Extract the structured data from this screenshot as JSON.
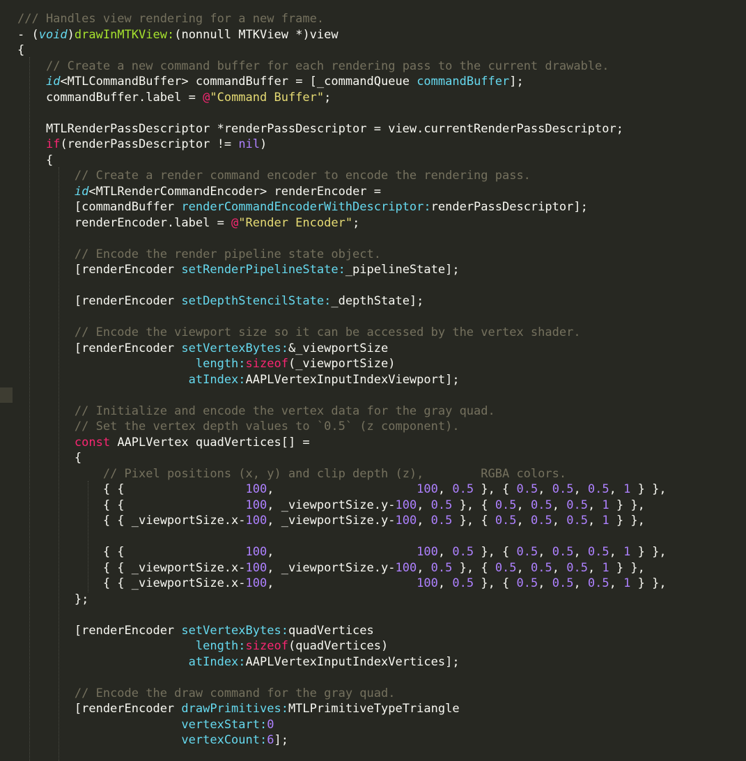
{
  "editor": {
    "theme": "monokai",
    "colors": {
      "background": "#272822",
      "comment": "#75715e",
      "keyword": "#f92672",
      "string": "#e6db74",
      "number": "#ae81ff",
      "function": "#a6e22e",
      "type": "#66d9ef",
      "plain": "#f8f8f2"
    },
    "lines": [
      [
        [
          "cm",
          "/// Handles view rendering for a new frame."
        ]
      ],
      [
        [
          "pl",
          "- ("
        ],
        [
          "ty",
          "void"
        ],
        [
          "pl",
          ")"
        ],
        [
          "fn",
          "drawInMTKView:"
        ],
        [
          "pl",
          "(nonnull MTKView *)view"
        ]
      ],
      [
        [
          "pl",
          "{"
        ]
      ],
      [
        [
          "pl",
          "    "
        ],
        [
          "cm",
          "// Create a new command buffer for each rendering pass to the current drawable."
        ]
      ],
      [
        [
          "pl",
          "    "
        ],
        [
          "ty",
          "id"
        ],
        [
          "pl",
          "<MTLCommandBuffer> commandBuffer = [_commandQueue "
        ],
        [
          "ms",
          "commandBuffer"
        ],
        [
          "pl",
          "];"
        ]
      ],
      [
        [
          "pl",
          "    commandBuffer.label = "
        ],
        [
          "kw",
          "@"
        ],
        [
          "st",
          "\"Command Buffer\""
        ],
        [
          "pl",
          ";"
        ]
      ],
      [
        [
          "pl",
          ""
        ]
      ],
      [
        [
          "pl",
          "    MTLRenderPassDescriptor *renderPassDescriptor = view.currentRenderPassDescriptor;"
        ]
      ],
      [
        [
          "pl",
          "    "
        ],
        [
          "kw",
          "if"
        ],
        [
          "pl",
          "(renderPassDescriptor != "
        ],
        [
          "nu",
          "nil"
        ],
        [
          "pl",
          ")"
        ]
      ],
      [
        [
          "pl",
          "    {"
        ]
      ],
      [
        [
          "pl",
          "        "
        ],
        [
          "cm",
          "// Create a render command encoder to encode the rendering pass."
        ]
      ],
      [
        [
          "pl",
          "        "
        ],
        [
          "ty",
          "id"
        ],
        [
          "pl",
          "<MTLRenderCommandEncoder> renderEncoder ="
        ]
      ],
      [
        [
          "pl",
          "        [commandBuffer "
        ],
        [
          "ms",
          "renderCommandEncoderWithDescriptor:"
        ],
        [
          "pl",
          "renderPassDescriptor];"
        ]
      ],
      [
        [
          "pl",
          "        renderEncoder.label = "
        ],
        [
          "kw",
          "@"
        ],
        [
          "st",
          "\"Render Encoder\""
        ],
        [
          "pl",
          ";"
        ]
      ],
      [
        [
          "pl",
          ""
        ]
      ],
      [
        [
          "pl",
          "        "
        ],
        [
          "cm",
          "// Encode the render pipeline state object."
        ]
      ],
      [
        [
          "pl",
          "        [renderEncoder "
        ],
        [
          "ms",
          "setRenderPipelineState:"
        ],
        [
          "pl",
          "_pipelineState];"
        ]
      ],
      [
        [
          "pl",
          ""
        ]
      ],
      [
        [
          "pl",
          "        [renderEncoder "
        ],
        [
          "ms",
          "setDepthStencilState:"
        ],
        [
          "pl",
          "_depthState];"
        ]
      ],
      [
        [
          "pl",
          ""
        ]
      ],
      [
        [
          "pl",
          "        "
        ],
        [
          "cm",
          "// Encode the viewport size so it can be accessed by the vertex shader."
        ]
      ],
      [
        [
          "pl",
          "        [renderEncoder "
        ],
        [
          "ms",
          "setVertexBytes:"
        ],
        [
          "pl",
          "&_viewportSize"
        ]
      ],
      [
        [
          "pl",
          "                         "
        ],
        [
          "ms",
          "length:"
        ],
        [
          "kw",
          "sizeof"
        ],
        [
          "pl",
          "(_viewportSize)"
        ]
      ],
      [
        [
          "pl",
          "                        "
        ],
        [
          "ms",
          "atIndex:"
        ],
        [
          "pl",
          "AAPLVertexInputIndexViewport];"
        ]
      ],
      [
        [
          "pl",
          ""
        ]
      ],
      [
        [
          "pl",
          "        "
        ],
        [
          "cm",
          "// Initialize and encode the vertex data for the gray quad."
        ]
      ],
      [
        [
          "pl",
          "        "
        ],
        [
          "cm",
          "// Set the vertex depth values to `0.5` (z component)."
        ]
      ],
      [
        [
          "pl",
          "        "
        ],
        [
          "kw",
          "const"
        ],
        [
          "pl",
          " AAPLVertex quadVertices[] ="
        ]
      ],
      [
        [
          "pl",
          "        {"
        ]
      ],
      [
        [
          "pl",
          "            "
        ],
        [
          "cm",
          "// Pixel positions (x, y) and clip depth (z),        RGBA colors."
        ]
      ],
      [
        [
          "pl",
          "            { {                 "
        ],
        [
          "nu",
          "100"
        ],
        [
          "pl",
          ",                    "
        ],
        [
          "nu",
          "100"
        ],
        [
          "pl",
          ", "
        ],
        [
          "nu",
          "0.5"
        ],
        [
          "pl",
          " }, { "
        ],
        [
          "nu",
          "0.5"
        ],
        [
          "pl",
          ", "
        ],
        [
          "nu",
          "0.5"
        ],
        [
          "pl",
          ", "
        ],
        [
          "nu",
          "0.5"
        ],
        [
          "pl",
          ", "
        ],
        [
          "nu",
          "1"
        ],
        [
          "pl",
          " } },"
        ]
      ],
      [
        [
          "pl",
          "            { {                 "
        ],
        [
          "nu",
          "100"
        ],
        [
          "pl",
          ", _viewportSize.y-"
        ],
        [
          "nu",
          "100"
        ],
        [
          "pl",
          ", "
        ],
        [
          "nu",
          "0.5"
        ],
        [
          "pl",
          " }, { "
        ],
        [
          "nu",
          "0.5"
        ],
        [
          "pl",
          ", "
        ],
        [
          "nu",
          "0.5"
        ],
        [
          "pl",
          ", "
        ],
        [
          "nu",
          "0.5"
        ],
        [
          "pl",
          ", "
        ],
        [
          "nu",
          "1"
        ],
        [
          "pl",
          " } },"
        ]
      ],
      [
        [
          "pl",
          "            { { _viewportSize.x-"
        ],
        [
          "nu",
          "100"
        ],
        [
          "pl",
          ", _viewportSize.y-"
        ],
        [
          "nu",
          "100"
        ],
        [
          "pl",
          ", "
        ],
        [
          "nu",
          "0.5"
        ],
        [
          "pl",
          " }, { "
        ],
        [
          "nu",
          "0.5"
        ],
        [
          "pl",
          ", "
        ],
        [
          "nu",
          "0.5"
        ],
        [
          "pl",
          ", "
        ],
        [
          "nu",
          "0.5"
        ],
        [
          "pl",
          ", "
        ],
        [
          "nu",
          "1"
        ],
        [
          "pl",
          " } },"
        ]
      ],
      [
        [
          "pl",
          ""
        ]
      ],
      [
        [
          "pl",
          "            { {                 "
        ],
        [
          "nu",
          "100"
        ],
        [
          "pl",
          ",                    "
        ],
        [
          "nu",
          "100"
        ],
        [
          "pl",
          ", "
        ],
        [
          "nu",
          "0.5"
        ],
        [
          "pl",
          " }, { "
        ],
        [
          "nu",
          "0.5"
        ],
        [
          "pl",
          ", "
        ],
        [
          "nu",
          "0.5"
        ],
        [
          "pl",
          ", "
        ],
        [
          "nu",
          "0.5"
        ],
        [
          "pl",
          ", "
        ],
        [
          "nu",
          "1"
        ],
        [
          "pl",
          " } },"
        ]
      ],
      [
        [
          "pl",
          "            { { _viewportSize.x-"
        ],
        [
          "nu",
          "100"
        ],
        [
          "pl",
          ", _viewportSize.y-"
        ],
        [
          "nu",
          "100"
        ],
        [
          "pl",
          ", "
        ],
        [
          "nu",
          "0.5"
        ],
        [
          "pl",
          " }, { "
        ],
        [
          "nu",
          "0.5"
        ],
        [
          "pl",
          ", "
        ],
        [
          "nu",
          "0.5"
        ],
        [
          "pl",
          ", "
        ],
        [
          "nu",
          "0.5"
        ],
        [
          "pl",
          ", "
        ],
        [
          "nu",
          "1"
        ],
        [
          "pl",
          " } },"
        ]
      ],
      [
        [
          "pl",
          "            { { _viewportSize.x-"
        ],
        [
          "nu",
          "100"
        ],
        [
          "pl",
          ",                    "
        ],
        [
          "nu",
          "100"
        ],
        [
          "pl",
          ", "
        ],
        [
          "nu",
          "0.5"
        ],
        [
          "pl",
          " }, { "
        ],
        [
          "nu",
          "0.5"
        ],
        [
          "pl",
          ", "
        ],
        [
          "nu",
          "0.5"
        ],
        [
          "pl",
          ", "
        ],
        [
          "nu",
          "0.5"
        ],
        [
          "pl",
          ", "
        ],
        [
          "nu",
          "1"
        ],
        [
          "pl",
          " } },"
        ]
      ],
      [
        [
          "pl",
          "        };"
        ]
      ],
      [
        [
          "pl",
          ""
        ]
      ],
      [
        [
          "pl",
          "        [renderEncoder "
        ],
        [
          "ms",
          "setVertexBytes:"
        ],
        [
          "pl",
          "quadVertices"
        ]
      ],
      [
        [
          "pl",
          "                         "
        ],
        [
          "ms",
          "length:"
        ],
        [
          "kw",
          "sizeof"
        ],
        [
          "pl",
          "(quadVertices)"
        ]
      ],
      [
        [
          "pl",
          "                        "
        ],
        [
          "ms",
          "atIndex:"
        ],
        [
          "pl",
          "AAPLVertexInputIndexVertices];"
        ]
      ],
      [
        [
          "pl",
          ""
        ]
      ],
      [
        [
          "pl",
          "        "
        ],
        [
          "cm",
          "// Encode the draw command for the gray quad."
        ]
      ],
      [
        [
          "pl",
          "        [renderEncoder "
        ],
        [
          "ms",
          "drawPrimitives:"
        ],
        [
          "pl",
          "MTLPrimitiveTypeTriangle"
        ]
      ],
      [
        [
          "pl",
          "                       "
        ],
        [
          "ms",
          "vertexStart:"
        ],
        [
          "nu",
          "0"
        ]
      ],
      [
        [
          "pl",
          "                       "
        ],
        [
          "ms",
          "vertexCount:"
        ],
        [
          "nu",
          "6"
        ],
        [
          "pl",
          "];"
        ]
      ]
    ]
  }
}
